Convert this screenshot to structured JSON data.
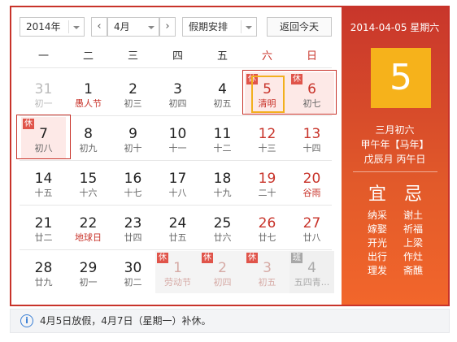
{
  "toolbar": {
    "year": "2014年",
    "month": "4月",
    "prev": "‹",
    "next": "›",
    "holiday_select": "假期安排",
    "today_button": "返回今天"
  },
  "weekdays": [
    "一",
    "二",
    "三",
    "四",
    "五",
    "六",
    "日"
  ],
  "weeks": [
    [
      {
        "day": "31",
        "sub": "初一",
        "other": true
      },
      {
        "day": "1",
        "sub": "愚人节",
        "festival": true
      },
      {
        "day": "2",
        "sub": "初三"
      },
      {
        "day": "3",
        "sub": "初四"
      },
      {
        "day": "4",
        "sub": "初五"
      },
      {
        "day": "5",
        "sub": "清明",
        "festival": true,
        "holiday": true,
        "badge": "休",
        "today": true
      },
      {
        "day": "6",
        "sub": "初七",
        "holiday": true,
        "badge": "休"
      }
    ],
    [
      {
        "day": "7",
        "sub": "初八",
        "holiday": true,
        "badge": "休"
      },
      {
        "day": "8",
        "sub": "初九"
      },
      {
        "day": "9",
        "sub": "初十"
      },
      {
        "day": "10",
        "sub": "十一"
      },
      {
        "day": "11",
        "sub": "十二"
      },
      {
        "day": "12",
        "sub": "十三"
      },
      {
        "day": "13",
        "sub": "十四"
      }
    ],
    [
      {
        "day": "14",
        "sub": "十五"
      },
      {
        "day": "15",
        "sub": "十六"
      },
      {
        "day": "16",
        "sub": "十七"
      },
      {
        "day": "17",
        "sub": "十八"
      },
      {
        "day": "18",
        "sub": "十九"
      },
      {
        "day": "19",
        "sub": "二十"
      },
      {
        "day": "20",
        "sub": "谷雨",
        "festival": true
      }
    ],
    [
      {
        "day": "21",
        "sub": "廿二"
      },
      {
        "day": "22",
        "sub": "地球日",
        "festival": true
      },
      {
        "day": "23",
        "sub": "廿四"
      },
      {
        "day": "24",
        "sub": "廿五"
      },
      {
        "day": "25",
        "sub": "廿六"
      },
      {
        "day": "26",
        "sub": "廿七"
      },
      {
        "day": "27",
        "sub": "廿八"
      }
    ],
    [
      {
        "day": "28",
        "sub": "廿九"
      },
      {
        "day": "29",
        "sub": "初一"
      },
      {
        "day": "30",
        "sub": "初二"
      },
      {
        "day": "1",
        "sub": "劳动节",
        "other": true,
        "holiday": true,
        "badge": "休"
      },
      {
        "day": "2",
        "sub": "初四",
        "other": true,
        "holiday": true,
        "badge": "休"
      },
      {
        "day": "3",
        "sub": "初五",
        "other": true,
        "holiday": true,
        "badge": "休"
      },
      {
        "day": "4",
        "sub": "五四青...",
        "other": true,
        "work": true,
        "badge": "班"
      }
    ]
  ],
  "side": {
    "date": "2014-04-05 星期六",
    "big_day": "5",
    "lunar": "三月初六",
    "year_gz": "甲午年【马年】",
    "month_gz": "戊辰月 丙午日",
    "yi_title": "宜",
    "ji_title": "忌",
    "yi": [
      "纳采",
      "嫁娶",
      "开光",
      "出行",
      "理发"
    ],
    "ji": [
      "谢土",
      "祈福",
      "上梁",
      "作灶",
      "斋醮"
    ]
  },
  "notice": {
    "icon": "info-icon",
    "text": "4月5日放假，4月7日（星期一）补休。"
  },
  "colors": {
    "accent_red": "#c8332a",
    "today_gold": "#f6b21b",
    "holiday_bg": "#fde9e7",
    "info_blue": "#3a7fd5"
  }
}
